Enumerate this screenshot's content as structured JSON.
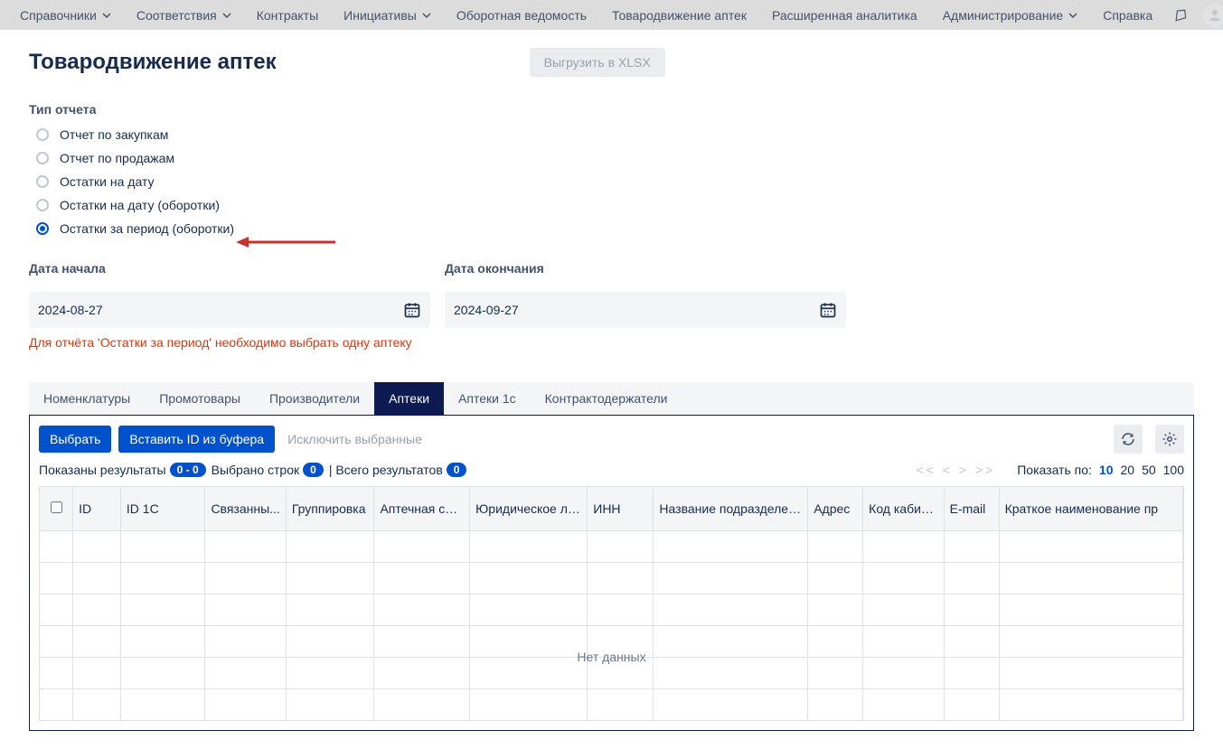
{
  "topnav": {
    "items": [
      {
        "label": "Справочники",
        "dropdown": true
      },
      {
        "label": "Соответствия",
        "dropdown": true
      },
      {
        "label": "Контракты",
        "dropdown": false
      },
      {
        "label": "Инициативы",
        "dropdown": true
      },
      {
        "label": "Оборотная ведомость",
        "dropdown": false
      },
      {
        "label": "Товародвижение аптек",
        "dropdown": false
      },
      {
        "label": "Расширенная аналитика",
        "dropdown": false
      },
      {
        "label": "Администрирование",
        "dropdown": true
      },
      {
        "label": "Справка",
        "dropdown": false
      }
    ]
  },
  "page": {
    "title": "Товародвижение аптек",
    "export_label": "Выгрузить в XLSX"
  },
  "report_type": {
    "label": "Тип отчета",
    "options": [
      {
        "label": "Отчет по закупкам",
        "selected": false
      },
      {
        "label": "Отчет по продажам",
        "selected": false
      },
      {
        "label": "Остатки на дату",
        "selected": false
      },
      {
        "label": "Остатки на дату (оборотки)",
        "selected": false
      },
      {
        "label": "Остатки за период (оборотки)",
        "selected": true
      }
    ]
  },
  "dates": {
    "start_label": "Дата начала",
    "start_value": "2024-08-27",
    "end_label": "Дата окончания",
    "end_value": "2024-09-27"
  },
  "warning_text": "Для отчёта 'Остатки за период' необходимо выбрать одну аптеку",
  "tabs": [
    {
      "label": "Номенклатуры",
      "active": false
    },
    {
      "label": "Промотовары",
      "active": false
    },
    {
      "label": "Производители",
      "active": false
    },
    {
      "label": "Аптеки",
      "active": true
    },
    {
      "label": "Аптеки 1с",
      "active": false
    },
    {
      "label": "Контрактодержатели",
      "active": false
    }
  ],
  "panel": {
    "select_btn": "Выбрать",
    "paste_btn": "Вставить ID из буфера",
    "exclude_disabled": "Исключить выбранные"
  },
  "results": {
    "shown_label": "Показаны результаты",
    "shown_value": "0 - 0",
    "selected_label": "Выбрано строк",
    "selected_value": "0",
    "total_label": "| Всего результатов",
    "total_value": "0",
    "pager": "<<  <  >  >>",
    "pagesize_label": "Показать по:",
    "pagesize_options": [
      "10",
      "20",
      "50",
      "100"
    ],
    "pagesize_active": "10"
  },
  "table": {
    "columns": [
      "ID",
      "ID 1C",
      "Связанны...",
      "Группировка",
      "Аптечная сеть",
      "Юридическое лицо",
      "ИНН",
      "Название подразделения",
      "Адрес",
      "Код кабинета",
      "E-mail",
      "Краткое наименование пр"
    ],
    "no_data": "Нет данных"
  }
}
